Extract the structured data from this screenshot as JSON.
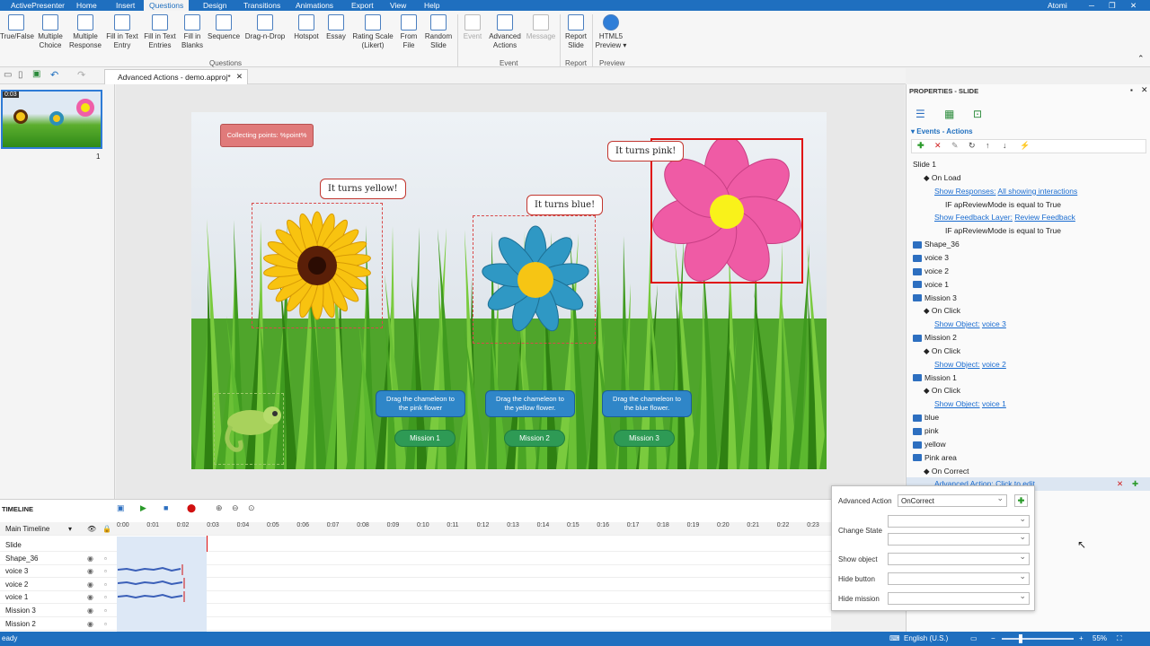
{
  "app": {
    "title": "ActivePresenter",
    "user": "Atomi"
  },
  "menu": [
    "Home",
    "Insert",
    "Questions",
    "Design",
    "Transitions",
    "Animations",
    "Export",
    "View",
    "Help"
  ],
  "menu_active": "Questions",
  "ribbon": {
    "question_items": [
      {
        "label1": "True/False",
        "label2": ""
      },
      {
        "label1": "Multiple",
        "label2": "Choice"
      },
      {
        "label1": "Multiple",
        "label2": "Response"
      },
      {
        "label1": "Fill in Text",
        "label2": "Entry"
      },
      {
        "label1": "Fill in Text",
        "label2": "Entries"
      },
      {
        "label1": "Fill in",
        "label2": "Blanks"
      },
      {
        "label1": "Sequence",
        "label2": ""
      },
      {
        "label1": "Drag-n-Drop",
        "label2": ""
      },
      {
        "label1": "Hotspot",
        "label2": ""
      },
      {
        "label1": "Essay",
        "label2": ""
      },
      {
        "label1": "Rating Scale",
        "label2": "(Likert)"
      },
      {
        "label1": "From",
        "label2": "File"
      },
      {
        "label1": "Random",
        "label2": "Slide"
      }
    ],
    "group_questions": "Questions",
    "event_items": [
      {
        "label1": "Event",
        "label2": ""
      },
      {
        "label1": "Advanced",
        "label2": "Actions"
      },
      {
        "label1": "Message",
        "label2": ""
      }
    ],
    "group_event": "Event",
    "report": {
      "label1": "Report",
      "label2": "Slide"
    },
    "group_report": "Report",
    "preview": {
      "label1": "HTML5",
      "label2": "Preview ▾"
    },
    "group_preview": "Preview"
  },
  "document_tab": "Advanced Actions - demo.approj*",
  "slide_panel": {
    "thumb_time": "0:03",
    "slide_number": "1"
  },
  "slide": {
    "points_label": "Collecting points: %point%",
    "bubbles": [
      "It turns yellow!",
      "It turns blue!",
      "It turns pink!"
    ],
    "instructions": [
      "Drag the chameleon to the pink flower",
      "Drag the chameleon to the yellow flower.",
      "Drag the chameleon to the blue flower."
    ],
    "missions": [
      "Mission 1",
      "Mission 2",
      "Mission 3"
    ]
  },
  "properties": {
    "title": "PROPERTIES - SLIDE",
    "section": "Events - Actions",
    "rows": [
      {
        "indent": 0,
        "text": "Slide 1",
        "link": "",
        "extra": "",
        "kind": "plain"
      },
      {
        "indent": 1,
        "text": "◆  On Load",
        "link": "",
        "extra": "",
        "kind": "plain"
      },
      {
        "indent": 2,
        "text": "",
        "link": "Show Responses:",
        "extra": "All showing interactions",
        "kind": "link"
      },
      {
        "indent": 3,
        "text": "IF apReviewMode is equal to True",
        "link": "",
        "extra": "",
        "kind": "plain"
      },
      {
        "indent": 2,
        "text": "",
        "link": "Show Feedback Layer:",
        "extra": "Review Feedback",
        "kind": "link"
      },
      {
        "indent": 3,
        "text": "IF apReviewMode is equal to True",
        "link": "",
        "extra": "",
        "kind": "plain"
      },
      {
        "indent": 0,
        "text": "Shape_36",
        "link": "",
        "extra": "",
        "kind": "icon"
      },
      {
        "indent": 0,
        "text": "voice 3",
        "link": "",
        "extra": "",
        "kind": "icon"
      },
      {
        "indent": 0,
        "text": "voice 2",
        "link": "",
        "extra": "",
        "kind": "icon"
      },
      {
        "indent": 0,
        "text": "voice 1",
        "link": "",
        "extra": "",
        "kind": "icon"
      },
      {
        "indent": 0,
        "text": "Mission 3",
        "link": "",
        "extra": "",
        "kind": "icon"
      },
      {
        "indent": 1,
        "text": "◆  On Click",
        "link": "",
        "extra": "",
        "kind": "plain"
      },
      {
        "indent": 2,
        "text": "",
        "link": "Show Object:",
        "extra": "voice 3",
        "kind": "link"
      },
      {
        "indent": 0,
        "text": "Mission 2",
        "link": "",
        "extra": "",
        "kind": "icon"
      },
      {
        "indent": 1,
        "text": "◆  On Click",
        "link": "",
        "extra": "",
        "kind": "plain"
      },
      {
        "indent": 2,
        "text": "",
        "link": "Show Object:",
        "extra": "voice 2",
        "kind": "link"
      },
      {
        "indent": 0,
        "text": "Mission 1",
        "link": "",
        "extra": "",
        "kind": "icon"
      },
      {
        "indent": 1,
        "text": "◆  On Click",
        "link": "",
        "extra": "",
        "kind": "plain"
      },
      {
        "indent": 2,
        "text": "",
        "link": "Show Object:",
        "extra": "voice 1",
        "kind": "link"
      },
      {
        "indent": 0,
        "text": "blue",
        "link": "",
        "extra": "",
        "kind": "icon"
      },
      {
        "indent": 0,
        "text": "pink",
        "link": "",
        "extra": "",
        "kind": "icon"
      },
      {
        "indent": 0,
        "text": "yellow",
        "link": "",
        "extra": "",
        "kind": "icon"
      },
      {
        "indent": 0,
        "text": "Pink area",
        "link": "",
        "extra": "",
        "kind": "icon"
      },
      {
        "indent": 1,
        "text": "◆  On Correct",
        "link": "",
        "extra": "",
        "kind": "plain"
      },
      {
        "indent": 2,
        "text": "",
        "link": "Advanced Action:",
        "extra": "Click to edit",
        "kind": "selected"
      }
    ]
  },
  "timeline": {
    "title": "TIMELINE",
    "main": "Main Timeline",
    "ticks": [
      "0:00",
      "0:01",
      "0:02",
      "0:03",
      "0:04",
      "0:05",
      "0:06",
      "0:07",
      "0:08",
      "0:09",
      "0:10",
      "0:11",
      "0:12",
      "0:13",
      "0:14",
      "0:15",
      "0:16",
      "0:17",
      "0:18",
      "0:19",
      "0:20",
      "0:21",
      "0:22",
      "0:23"
    ],
    "rows": [
      "Slide",
      "Shape_36",
      "voice 3",
      "voice 2",
      "voice 1",
      "Mission 3",
      "Mission 2"
    ]
  },
  "popup": {
    "advanced_action_label": "Advanced Action",
    "advanced_action_value": "OnCorrect",
    "change_state_label": "Change State",
    "show_object_label": "Show object",
    "hide_button_label": "Hide button",
    "hide_mission_label": "Hide mission"
  },
  "status": {
    "left": "eady",
    "language": "English (U.S.)",
    "zoom": "55%"
  }
}
